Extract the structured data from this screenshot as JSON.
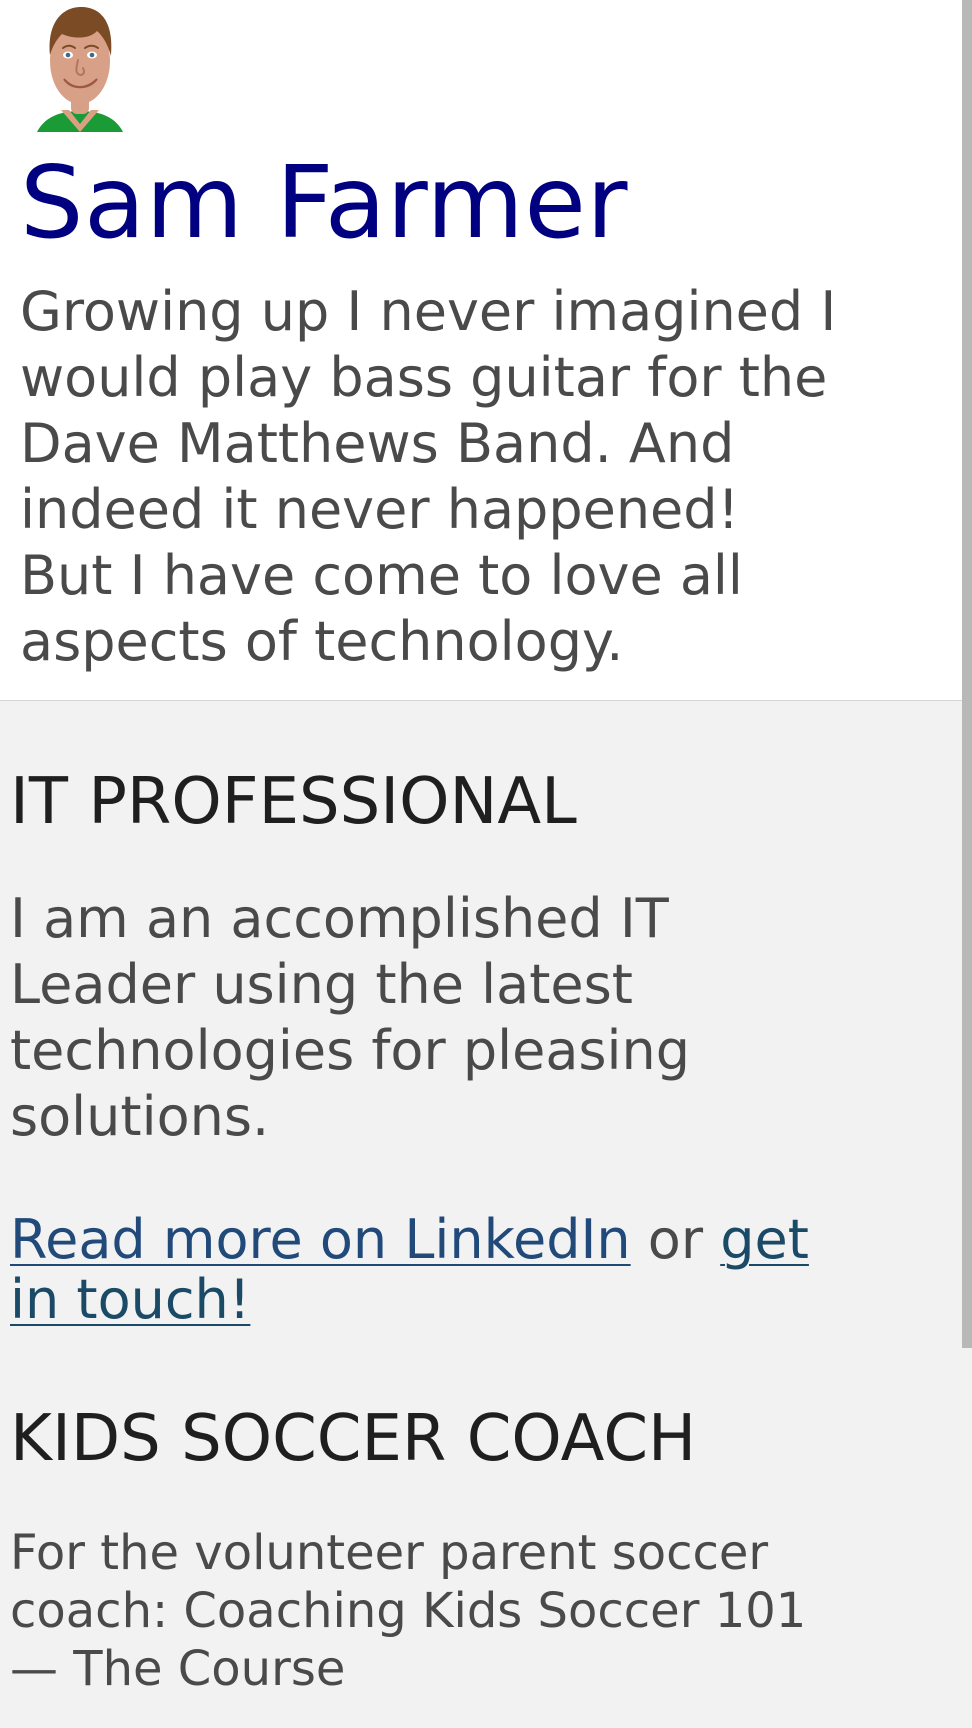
{
  "profile": {
    "name": "Sam Farmer",
    "tagline": "Growing up I never imagined I\nwould play bass guitar for the\nDave Matthews Band. And\nindeed it never happened!\nBut I have come to love all\naspects of technology.",
    "avatar_icon": "profile-photo"
  },
  "it_section": {
    "title": "IT PROFESSIONAL",
    "body": "I am an accomplished IT\nLeader using the latest\ntechnologies for pleasing\nsolutions.",
    "linkedin_label": "Read more on LinkedIn",
    "connector": " or ",
    "contact_label": "get\nin touch!"
  },
  "soccer_section": {
    "title": "KIDS SOCCER COACH",
    "body": "For the volunteer parent soccer\ncoach: Coaching Kids Soccer 101\n— The Course"
  },
  "colors": {
    "name_color": "#000080",
    "heading_color": "#1f1f1f",
    "body_color": "#4a4a4a",
    "link_color": "#214a7b",
    "background": "#f2f2f2",
    "hero_background": "#ffffff"
  }
}
